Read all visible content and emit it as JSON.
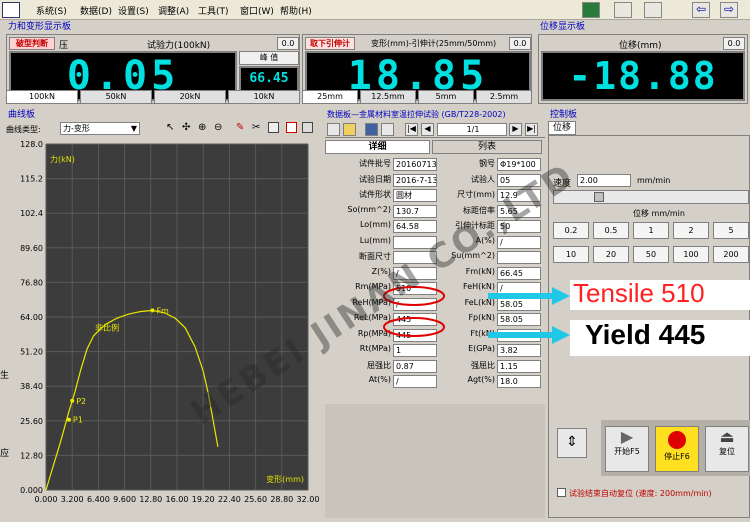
{
  "menu": {
    "items": [
      "系统(S)",
      "数据(D)",
      "设置(S)",
      "调整(A)",
      "工具(T)",
      "窗口(W)",
      "帮助(H)"
    ]
  },
  "force_panel": {
    "title": "力和变形显示板",
    "tab_label": "破型判断",
    "tab_unit": "压",
    "channel": "试验力(100kN)",
    "zero": "0.0",
    "value": "0.05",
    "peak_label": "峰 值",
    "peak_value": "66.45",
    "ranges": [
      "100kN",
      "50kN",
      "20kN",
      "10kN"
    ]
  },
  "ext_panel": {
    "button": "取下引伸计",
    "channel": "变形(mm)-引伸计(25mm/50mm)",
    "zero": "0.0",
    "value": "18.85",
    "ranges": [
      "25mm",
      "12.5mm",
      "5mm",
      "2.5mm"
    ]
  },
  "disp_panel": {
    "title": "位移显示板",
    "channel": "位移(mm)",
    "zero": "0.0",
    "value": "-18.88"
  },
  "curve_panel": {
    "title": "曲线板",
    "type_label": "曲线类型:",
    "type_value": "力-变形"
  },
  "chart_data": {
    "type": "line",
    "title": "",
    "ylabel": "力(kN)",
    "xlabel": "变形(mm)",
    "xlim": [
      0,
      32
    ],
    "ylim": [
      0,
      128
    ],
    "x_ticks": [
      "0.000",
      "3.200",
      "6.400",
      "9.600",
      "12.80",
      "16.00",
      "19.20",
      "22.40",
      "25.60",
      "28.80",
      "32.00"
    ],
    "y_ticks": [
      "0.000",
      "12.80",
      "25.60",
      "38.40",
      "51.20",
      "64.00",
      "76.80",
      "89.60",
      "102.4",
      "115.2",
      "128.0"
    ],
    "series": [
      {
        "name": "",
        "x": [
          0,
          0.8,
          1.8,
          2.8,
          3.5,
          4.2,
          5.0,
          5.8,
          6.6,
          7.4,
          8.6,
          10,
          11.5,
          13,
          14.5,
          15.8,
          17,
          18.2,
          19.2,
          19.8,
          20.4,
          21.0
        ],
        "y": [
          0,
          8,
          18,
          29,
          36,
          44,
          52,
          57,
          59.5,
          61.5,
          63.5,
          65,
          66,
          66.45,
          65.5,
          63.5,
          60,
          53,
          44,
          36,
          26,
          16
        ]
      }
    ],
    "markers": [
      {
        "label": "P1",
        "x": 2.8,
        "y": 26
      },
      {
        "label": "P2",
        "x": 3.2,
        "y": 33
      },
      {
        "label": "Fm",
        "x": 13.0,
        "y": 66.45
      }
    ],
    "annotations": [
      "非比例"
    ]
  },
  "data_panel": {
    "title": "数据板—金属材料室温拉伸试验 (GB/T228-2002)",
    "page": "1/1",
    "tab_detail": "详细",
    "tab_list": "列表",
    "fields_left": [
      {
        "label": "试件批号",
        "value": "20160713"
      },
      {
        "label": "试验日期",
        "value": "2016-7-13"
      },
      {
        "label": "试件形状",
        "value": "圆材"
      },
      {
        "label": "So(mm^2)",
        "value": "130.7"
      },
      {
        "label": "Lo(mm)",
        "value": "64.58"
      },
      {
        "label": "Lu(mm)",
        "value": ""
      },
      {
        "label": "断面尺寸",
        "value": ""
      },
      {
        "label": "Z(%)",
        "value": "/"
      },
      {
        "label": "Rm(MPa)",
        "value": "510"
      },
      {
        "label": "ReH(MPa)",
        "value": "/"
      },
      {
        "label": "ReL(MPa)",
        "value": "445"
      },
      {
        "label": "Rp(MPa)",
        "value": "445"
      },
      {
        "label": "Rt(MPa)",
        "value": "1"
      },
      {
        "label": "屈强比",
        "value": "0.87"
      },
      {
        "label": "At(%)",
        "value": "/"
      }
    ],
    "fields_right": [
      {
        "label": "钢号",
        "value": "Φ19*100"
      },
      {
        "label": "试验人",
        "value": "05"
      },
      {
        "label": "尺寸(mm)",
        "value": "12.9"
      },
      {
        "label": "标距倍率",
        "value": "5.65"
      },
      {
        "label": "引伸计标距",
        "value": "50"
      },
      {
        "label": "A(%)",
        "value": "/"
      },
      {
        "label": "Su(mm^2)",
        "value": ""
      },
      {
        "label": "Fm(kN)",
        "value": "66.45"
      },
      {
        "label": "FeH(kN)",
        "value": "/"
      },
      {
        "label": "FeL(kN)",
        "value": "58.05"
      },
      {
        "label": "Fp(kN)",
        "value": "58.05"
      },
      {
        "label": "Ft(kN)",
        "value": "0.15"
      },
      {
        "label": "E(GPa)",
        "value": "3.82"
      },
      {
        "label": "强屈比",
        "value": "1.15"
      },
      {
        "label": "Agt(%)",
        "value": "18.0"
      }
    ]
  },
  "annotations": {
    "tensile": "Tensile 510",
    "yield": "Yield 445",
    "colors": {
      "tensile": "#ff2020",
      "yield": "#000000",
      "arrow": "#20c8e8",
      "ellipse": "#e00000"
    }
  },
  "control_panel": {
    "title": "控制板",
    "tab": "位移",
    "speed_label": "速度",
    "speed_value": "2.00",
    "speed_unit": "mm/min",
    "pos_label": "位移 mm/min",
    "speed_buttons": [
      "0.2",
      "0.5",
      "1",
      "2",
      "5",
      "10",
      "20",
      "50",
      "100",
      "200"
    ],
    "selected": "2",
    "start": "开始F5",
    "stop": "停止F6",
    "reset": "复位",
    "auto_reset": "试验结束自动复位 (速度: 200mm/min)"
  },
  "watermark": "HEBEI JINAN CO.,LTD",
  "left_edge": {
    "label1": "生",
    "label2": "应"
  }
}
